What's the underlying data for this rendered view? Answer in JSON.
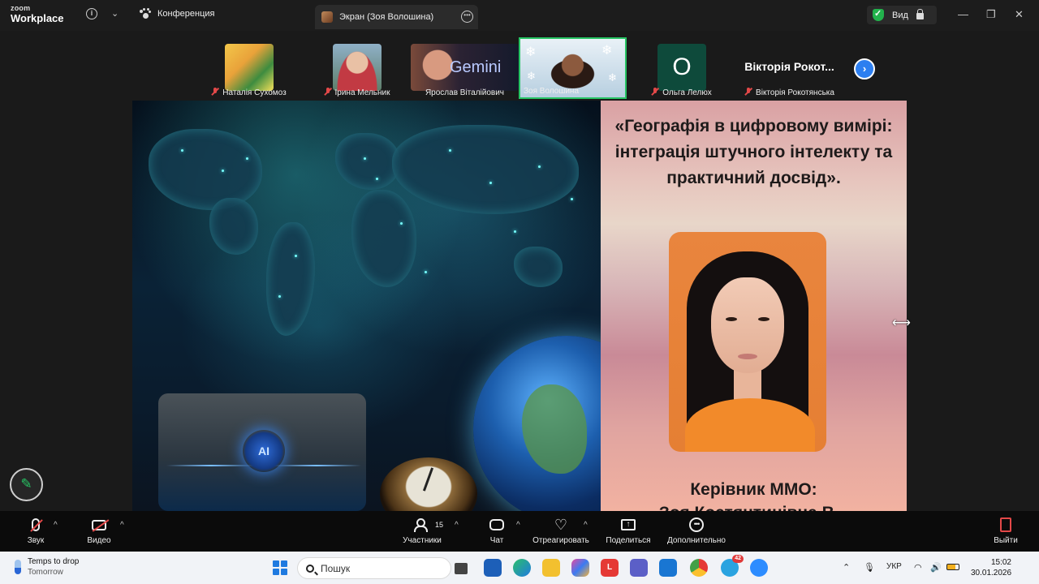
{
  "app": {
    "logo_line1": "zoom",
    "logo_line2": "Workplace",
    "meeting_tab": "Конференция",
    "screen_tab": "Экран (Зоя Волошина)",
    "view_label": "Вид"
  },
  "participants": [
    {
      "name": "Наталія Сухомоз",
      "muted": true
    },
    {
      "name": "Ірина Мельник",
      "muted": true
    },
    {
      "name": "Ярослав Віталійович",
      "muted": false,
      "overlay_text": "Gemini"
    },
    {
      "name": "Зоя Волошина",
      "muted": false,
      "active_speaker": true
    },
    {
      "name": "Ольга Лелюх",
      "muted": true,
      "initial": "О"
    },
    {
      "name": "Вікторія Рокотянська",
      "muted": true,
      "tile_text": "Вікторія Рокот..."
    }
  ],
  "slide": {
    "title": "«Географія в цифровому вимірі: інтеграція штучного інтелекту та практичний досвід».",
    "ai_badge": "AI",
    "subtitle": "Керівник ММО:",
    "subtitle_cut": "Зоя Костянтинівна В..."
  },
  "toolbar": {
    "audio": "Звук",
    "video": "Видео",
    "participants": "Участники",
    "participants_count": "15",
    "chat": "Чат",
    "react": "Отреагировать",
    "share": "Поделиться",
    "more": "Дополнительно",
    "leave": "Выйти"
  },
  "taskbar": {
    "weather_title": "Temps to drop",
    "weather_sub": "Tomorrow",
    "search_placeholder": "Пошук",
    "telegram_badge": "42",
    "lang": "УКР",
    "time": "15:02",
    "date": "30.01.2026"
  },
  "colors": {
    "active_border": "#27c464",
    "muted_red": "#e34848",
    "accent_blue": "#2d7ff0"
  }
}
